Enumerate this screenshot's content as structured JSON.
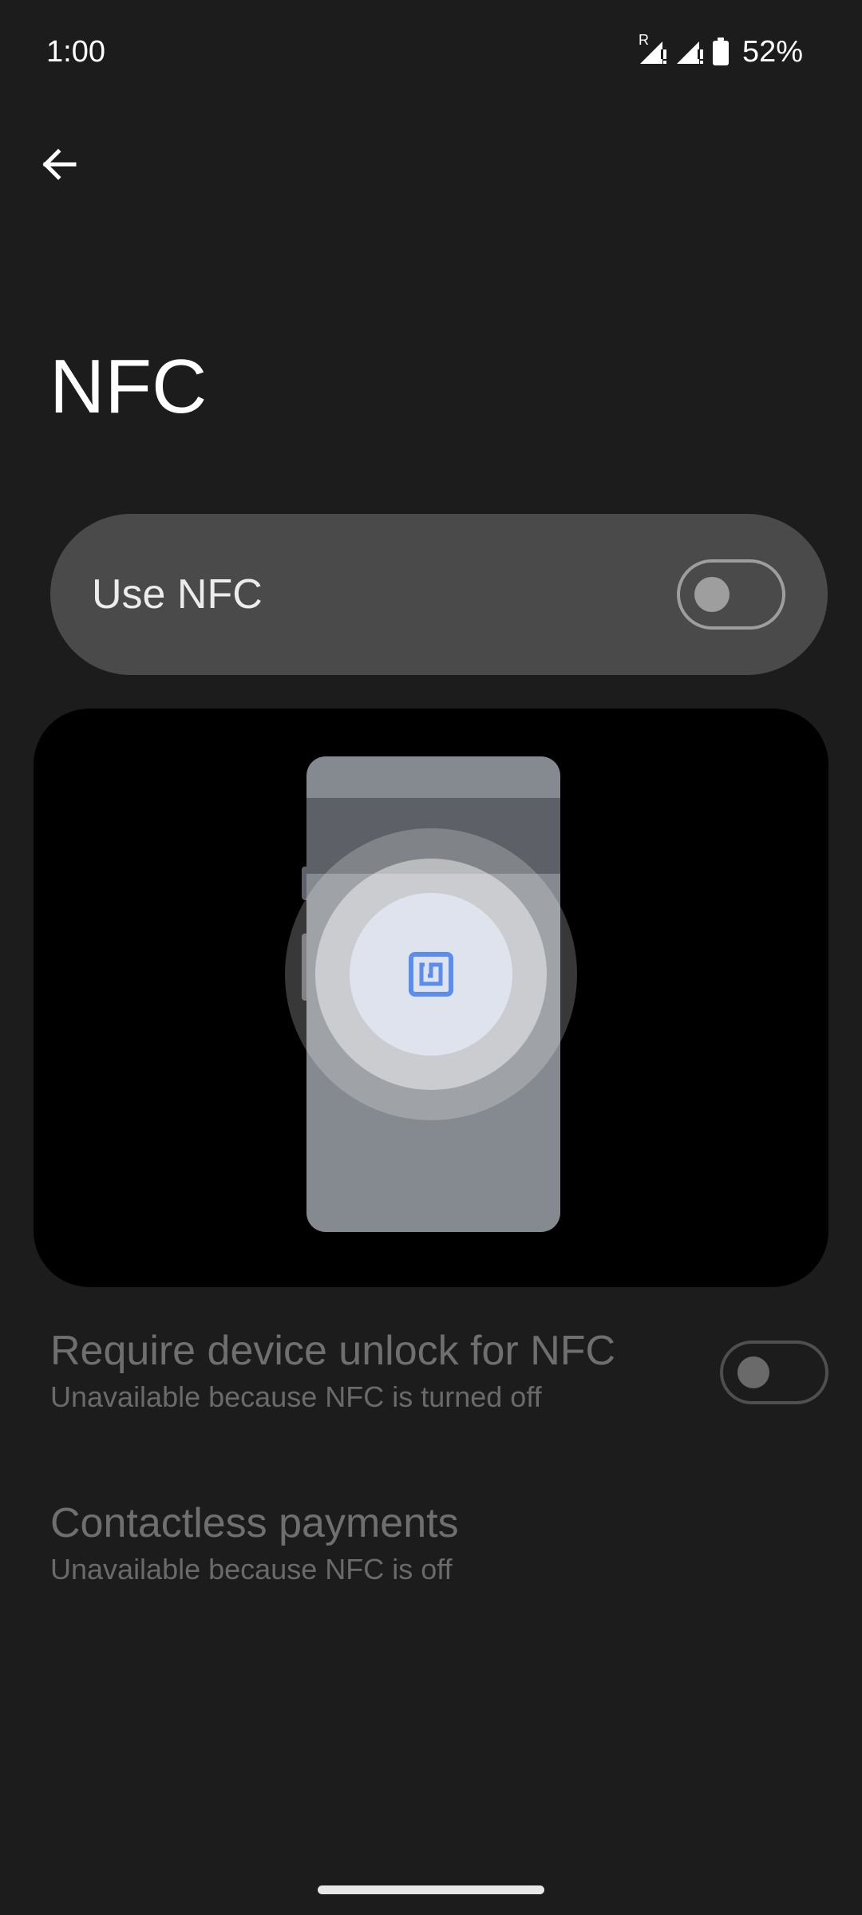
{
  "status_bar": {
    "time": "1:00",
    "battery_percent": "52%",
    "roaming_indicator": "R",
    "icons": [
      "signal-roaming-icon",
      "signal-icon",
      "battery-icon"
    ]
  },
  "header": {
    "back_icon": "arrow-back-icon"
  },
  "page": {
    "title": "NFC"
  },
  "main_toggle": {
    "label": "Use NFC",
    "checked": false
  },
  "illustration": {
    "icon": "nfc-icon",
    "accent_color": "#5b8def"
  },
  "settings": [
    {
      "title": "Require device unlock for NFC",
      "subtitle": "Unavailable because NFC is turned off",
      "has_switch": true,
      "checked": false,
      "enabled": false
    },
    {
      "title": "Contactless payments",
      "subtitle": "Unavailable because NFC is off",
      "has_switch": false,
      "enabled": false
    }
  ],
  "colors": {
    "background": "#1c1c1c",
    "card": "#4a4a4a",
    "disabled_text": "#6f6f6f"
  }
}
